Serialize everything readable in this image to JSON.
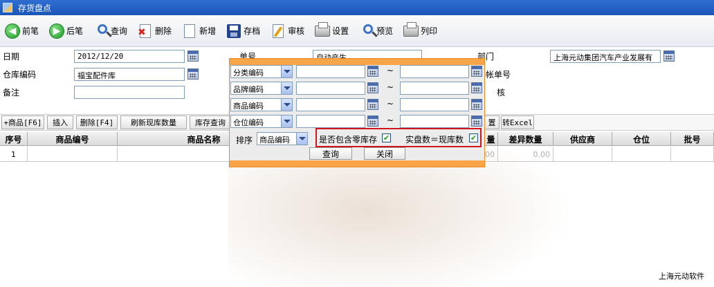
{
  "window": {
    "title": "存货盘点"
  },
  "toolbar": {
    "prev": "前笔",
    "next": "后笔",
    "query": "查询",
    "delete": "删除",
    "new": "新增",
    "save": "存档",
    "review": "审核",
    "settings": "设置",
    "preview": "预览",
    "print": "列印"
  },
  "form": {
    "date_label": "日期",
    "date_value": "2012/12/20",
    "warehouse_label": "仓库编码",
    "warehouse_value": "福宝配件库",
    "note_label": "备注",
    "note_value": "",
    "doc_no_label": "单号",
    "doc_no_value": "自动产生",
    "dept_label": "部门",
    "dept_value": "上海元动集团汽车产业发展有",
    "account_no_label": "帐单号",
    "review_label": "核"
  },
  "actions": {
    "add_goods": "+商品[F6]",
    "insert": "插入",
    "delete_row": "删除[F4]",
    "refresh_stock": "刷新现库数量",
    "stock_query": "库存查询",
    "settings_partial": "置",
    "to_excel": "转Excel"
  },
  "grid": {
    "headers": [
      "序号",
      "商品编号",
      "商品名称",
      "量",
      "差异数量",
      "供应商",
      "仓位",
      "批号"
    ],
    "rows": [
      {
        "seq": "1",
        "qty": "00",
        "diff": "0.00"
      }
    ]
  },
  "popup": {
    "filters": [
      {
        "field": "分类编码"
      },
      {
        "field": "品牌编码"
      },
      {
        "field": "商品编码"
      },
      {
        "field": "仓位编码"
      }
    ],
    "tilde": "~",
    "sort_label": "排序",
    "sort_value": "商品编码",
    "include_zero_label": "是否包含零库存",
    "include_zero_checked": true,
    "equal_stock_label": "实盘数＝现库数",
    "equal_stock_checked": true,
    "query_button": "查询",
    "close_button": "关闭"
  },
  "footer": {
    "company": "上海元动软件"
  }
}
